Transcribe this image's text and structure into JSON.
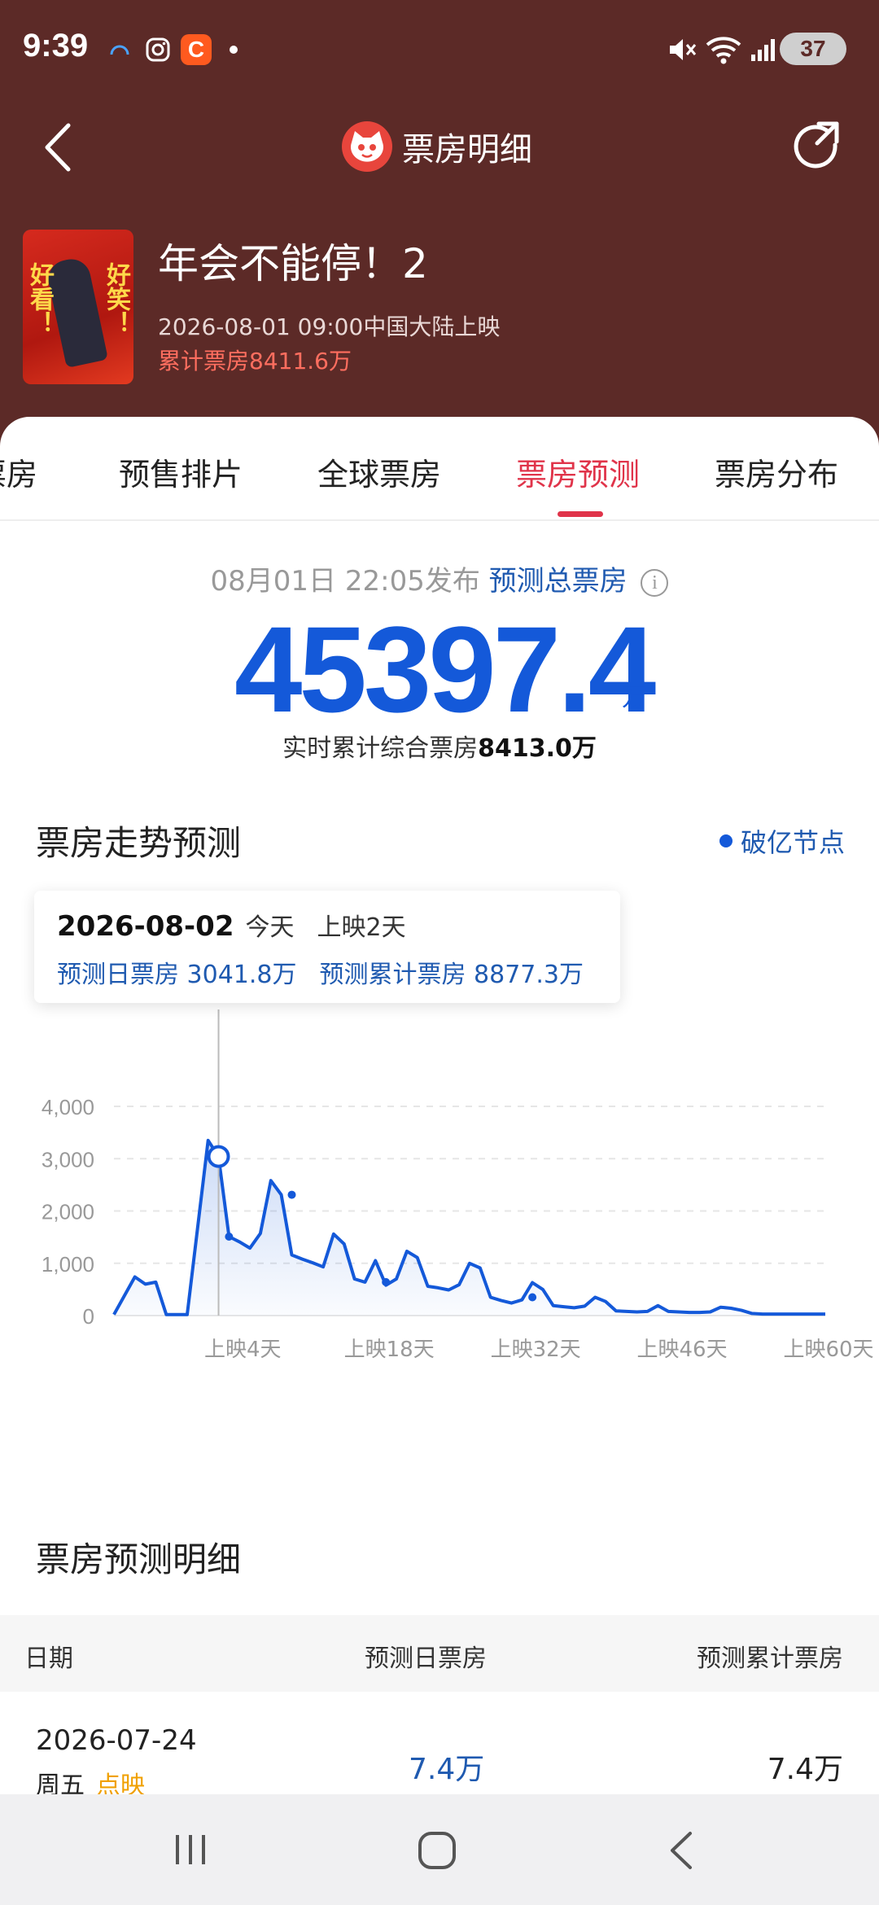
{
  "status_bar": {
    "time": "9:39",
    "battery": "37",
    "app_icon_c": "C"
  },
  "nav": {
    "title": "票房明细"
  },
  "movie": {
    "title": "年会不能停！2",
    "release": "2026-08-01 09:00中国大陆上映",
    "total": "累计票房8411.6万",
    "poster_text_left": "好看！",
    "poster_text_right": "好笑！"
  },
  "tabs": [
    {
      "label": "票房"
    },
    {
      "label": "预售排片"
    },
    {
      "label": "全球票房"
    },
    {
      "label": "票房预测",
      "active": true
    },
    {
      "label": "票房分布"
    }
  ],
  "forecast": {
    "published": "08月01日 22:05发布",
    "label": "预测总票房",
    "value": "45397.4",
    "unit": "万",
    "realtime_label": "实时累计综合票房",
    "realtime_value": "8413.0万"
  },
  "trend": {
    "title": "票房走势预测",
    "legend": "破亿节点"
  },
  "tooltip": {
    "date": "2026-08-02",
    "today": "今天",
    "day_label": "上映2天",
    "daily": "预测日票房 3041.8万",
    "cumulative": "预测累计票房 8877.3万"
  },
  "chart_data": {
    "type": "area",
    "x_tick_labels": [
      "上映4天",
      "上映18天",
      "上映32天",
      "上映46天",
      "上映60天"
    ],
    "y_tick_labels": [
      "0",
      "1,000",
      "2,000",
      "3,000",
      "4,000"
    ],
    "ylim": [
      0,
      4000
    ],
    "x": [
      -8,
      -6,
      -5,
      -4,
      -3,
      -2,
      -1,
      1,
      2,
      3,
      4,
      5,
      6,
      7,
      8,
      9,
      10,
      11,
      12,
      13,
      14,
      15,
      16,
      17,
      18,
      19,
      20,
      21,
      22,
      23,
      24,
      25,
      26,
      27,
      28,
      29,
      30,
      31,
      32,
      33,
      34,
      35,
      36,
      37,
      38,
      39,
      40,
      41,
      42,
      43,
      44,
      45,
      46,
      47,
      48,
      49,
      50,
      51,
      52,
      53,
      54,
      55,
      56,
      57,
      58,
      59,
      60
    ],
    "values": [
      20,
      740,
      600,
      640,
      20,
      20,
      20,
      3350,
      3040,
      1510,
      1410,
      1290,
      1570,
      2580,
      2310,
      1160,
      1080,
      1010,
      930,
      1560,
      1370,
      700,
      640,
      1050,
      580,
      700,
      1230,
      1110,
      560,
      530,
      490,
      590,
      1000,
      910,
      350,
      290,
      240,
      300,
      630,
      500,
      190,
      170,
      150,
      180,
      350,
      270,
      90,
      80,
      70,
      80,
      190,
      80,
      70,
      60,
      60,
      70,
      160,
      140,
      100,
      40,
      30,
      30,
      30,
      30,
      30,
      30,
      30
    ],
    "highlight_x": 2,
    "highlight_value": 3041.8,
    "milestone_points": [
      {
        "x": 3,
        "value": 1510
      },
      {
        "x": 9,
        "value": 2310
      },
      {
        "x": 18,
        "value": 640
      },
      {
        "x": 32,
        "value": 350
      }
    ],
    "color": "#1459d9"
  },
  "detail": {
    "title": "票房预测明细",
    "headers": [
      "日期",
      "预测日票房",
      "预测累计票房"
    ],
    "rows": [
      {
        "date": "2026-07-24",
        "weekday": "周五",
        "tag": "点映",
        "daily": "7.4万",
        "cumulative": "7.4万"
      }
    ]
  },
  "colors": {
    "header_bg": "#5c2a27",
    "active_tab": "#e0344a",
    "primary_blue": "#1459d9"
  }
}
